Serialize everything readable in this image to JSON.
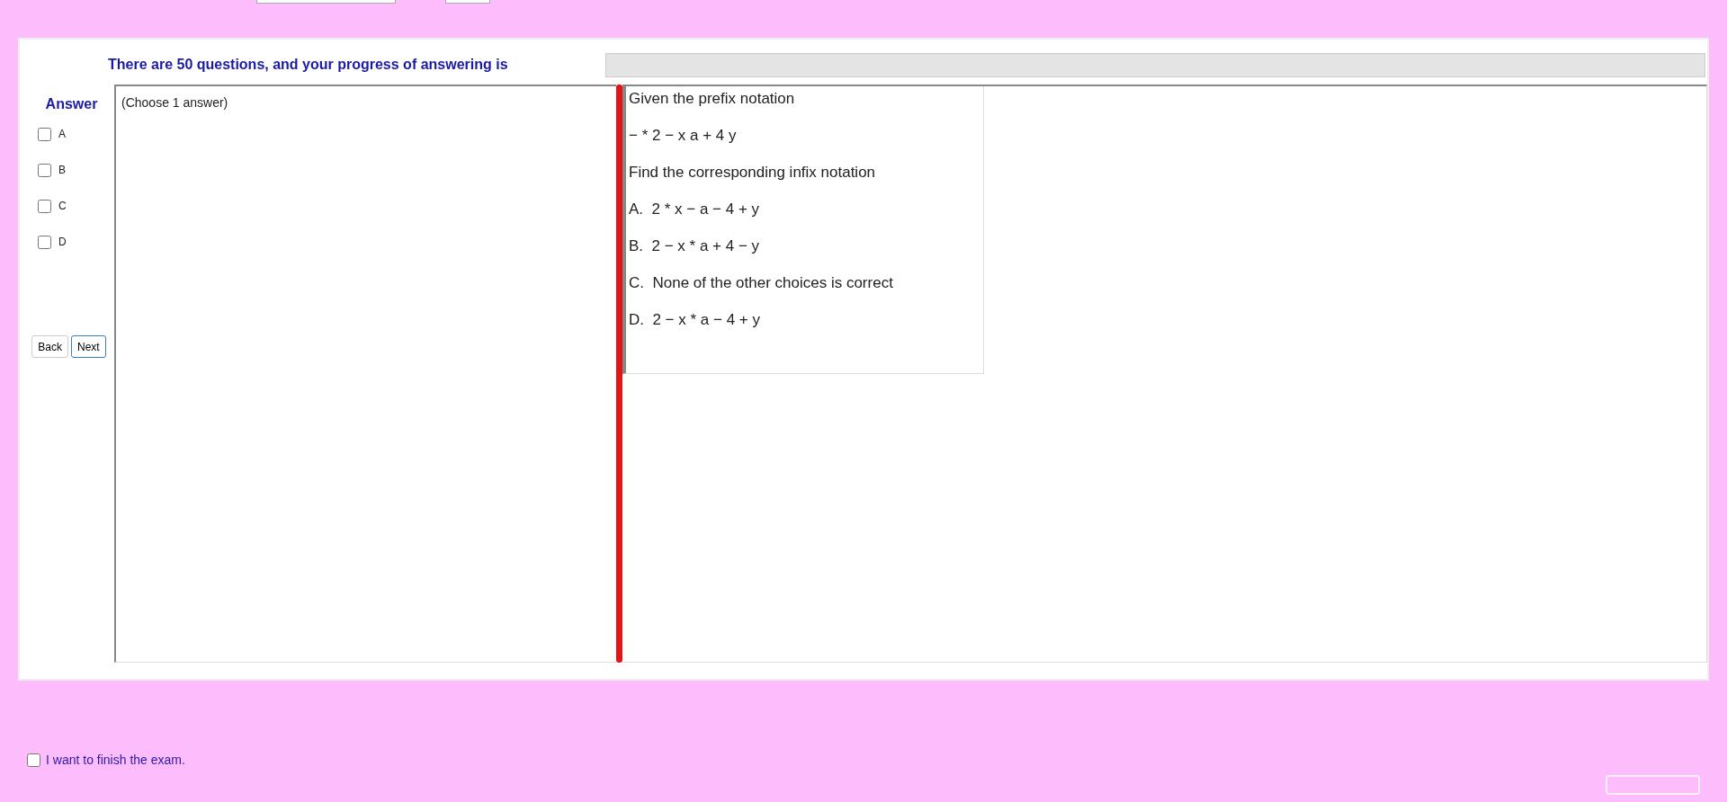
{
  "progress": {
    "text": "There are 50 questions, and your progress of answering is",
    "level": 0
  },
  "answer": {
    "heading": "Answer",
    "options": [
      {
        "label": "A",
        "checked": false
      },
      {
        "label": "B",
        "checked": false
      },
      {
        "label": "C",
        "checked": false
      },
      {
        "label": "D",
        "checked": false
      }
    ]
  },
  "buttons": [
    {
      "label": "Back",
      "selected": false
    },
    {
      "label": "Next",
      "selected": true
    }
  ],
  "instruction": "(Choose 1 answer)",
  "question": [
    "Given the prefix notation",
    "− * 2 − x a + 4 y",
    "Find the corresponding infix notation",
    "A.  2 * x − a − 4 + y",
    "B.  2 − x * a + 4 − y",
    "C.  None of the other choices is correct",
    "D.  2 − x * a − 4 + y"
  ],
  "finish": {
    "label": "I want to finish the exam.",
    "checked": false
  }
}
